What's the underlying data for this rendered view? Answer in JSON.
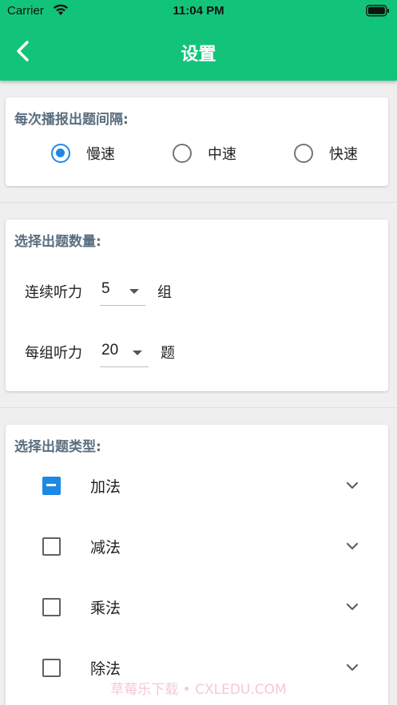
{
  "status_bar": {
    "carrier": "Carrier",
    "time": "11:04 PM"
  },
  "header": {
    "title": "设置"
  },
  "interval": {
    "title": "每次播报出题间隔:",
    "options": [
      {
        "label": "慢速",
        "selected": true
      },
      {
        "label": "中速",
        "selected": false
      },
      {
        "label": "快速",
        "selected": false
      }
    ]
  },
  "count": {
    "title": "选择出题数量:",
    "rows": [
      {
        "label": "连续听力",
        "value": "5",
        "unit": "组"
      },
      {
        "label": "每组听力",
        "value": "20",
        "unit": "题"
      }
    ]
  },
  "types": {
    "title": "选择出题类型:",
    "items": [
      {
        "label": "加法",
        "state": "partial"
      },
      {
        "label": "减法",
        "state": "unchecked"
      },
      {
        "label": "乘法",
        "state": "unchecked"
      },
      {
        "label": "除法",
        "state": "unchecked"
      }
    ]
  },
  "watermark": "草莓乐下载 • CXLEDU.COM",
  "colors": {
    "header": "#12c47a",
    "accent": "#1e88e5",
    "section_title": "#5a6e7f"
  }
}
